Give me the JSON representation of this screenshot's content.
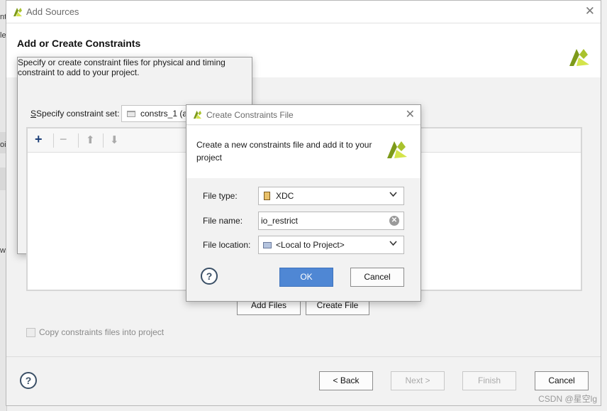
{
  "background": {
    "fragments": [
      "nt",
      "le",
      "oil",
      "w"
    ]
  },
  "main_dialog": {
    "title": "Add Sources",
    "close_glyph": "✕",
    "heading": "Add or Create Constraints",
    "subtitle": "Specify or create constraint files for physical and timing constraint to add to your project.",
    "constraint_set_label": "Specify constraint set:",
    "constraint_set_value": "constrs_1 (a",
    "toolbar": {
      "add_icon": "plus-icon",
      "remove_icon": "minus-icon",
      "up_icon": "arrow-up-icon",
      "down_icon": "arrow-down-icon"
    },
    "add_files_label": "Add Files",
    "create_file_label": "Create File",
    "copy_checkbox_label": "Copy constraints files into project",
    "copy_checkbox_checked": false,
    "help_glyph": "?",
    "back_label": "< Back",
    "next_label": "Next >",
    "finish_label": "Finish",
    "cancel_label": "Cancel"
  },
  "sub_dialog": {
    "title": "Create Constraints File",
    "close_glyph": "✕",
    "description": "Create a new constraints file and add it to your project",
    "file_type_label": "File type:",
    "file_type_value": "XDC",
    "file_name_label": "File name:",
    "file_name_value": "io_restrict",
    "file_location_label": "File location:",
    "file_location_value": "<Local to Project>",
    "help_glyph": "?",
    "ok_label": "OK",
    "cancel_label": "Cancel"
  },
  "watermark": "CSDN @星空lg",
  "colors": {
    "logo_dark": "#7d9a1a",
    "logo_light": "#d4e44a",
    "primary_button": "#4f87d4",
    "help_ring": "#3a4f66"
  }
}
